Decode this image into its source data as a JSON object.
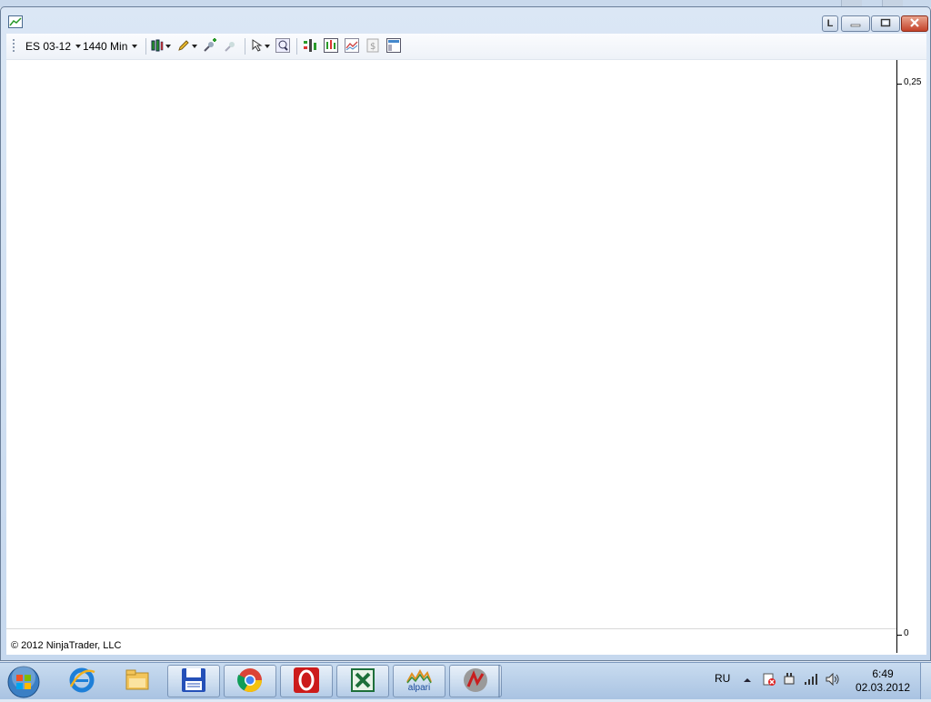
{
  "window": {
    "corner_button_label": "L"
  },
  "toolbar": {
    "instrument": "ES 03-12",
    "interval": "1440 Min"
  },
  "chart": {
    "price_labels": [
      "0,25",
      "0"
    ],
    "copyright": "© 2012 NinjaTrader, LLC"
  },
  "taskbar": {
    "apps": [
      {
        "name": "internet-explorer"
      },
      {
        "name": "file-explorer"
      },
      {
        "name": "save-app"
      },
      {
        "name": "chrome"
      },
      {
        "name": "opera"
      },
      {
        "name": "excel"
      },
      {
        "name": "alpari",
        "label": "alpari"
      },
      {
        "name": "ninjatrader"
      }
    ],
    "language": "RU",
    "time": "6:49",
    "date": "02.03.2012"
  },
  "colors": {
    "taskbar": "#a9c3e2",
    "close_button": "#c4432a",
    "chart_background": "#ffffff"
  }
}
